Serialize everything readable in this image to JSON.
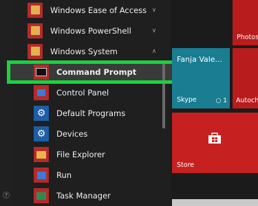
{
  "start_menu": {
    "items": [
      {
        "label": "Windows Ease of Access",
        "icon": "folder-icon",
        "chevron": "chevron-down-icon"
      },
      {
        "label": "Windows PowerShell",
        "icon": "folder-icon",
        "chevron": "chevron-down-icon"
      },
      {
        "label": "Windows System",
        "icon": "folder-icon",
        "chevron": "chevron-up-icon"
      },
      {
        "label": "Command Prompt",
        "icon": "command-prompt-icon"
      },
      {
        "label": "Control Panel",
        "icon": "control-panel-icon"
      },
      {
        "label": "Default Programs",
        "icon": "gear-icon"
      },
      {
        "label": "Devices",
        "icon": "gear-icon"
      },
      {
        "label": "File Explorer",
        "icon": "folder-icon"
      },
      {
        "label": "Run",
        "icon": "run-icon"
      },
      {
        "label": "Task Manager",
        "icon": "task-manager-icon"
      }
    ]
  },
  "tiles": {
    "people_name": "Fanja Vale...",
    "skype_label": "Skype",
    "skype_badge": "1",
    "autocheck_label": "Autoch",
    "photos_label": "Photos",
    "store_label": "Store"
  },
  "colors": {
    "highlight": "#18d43c",
    "tile_red": "#c72020",
    "tile_teal": "#1a7d91",
    "settings_blue": "#1e5ea8"
  }
}
